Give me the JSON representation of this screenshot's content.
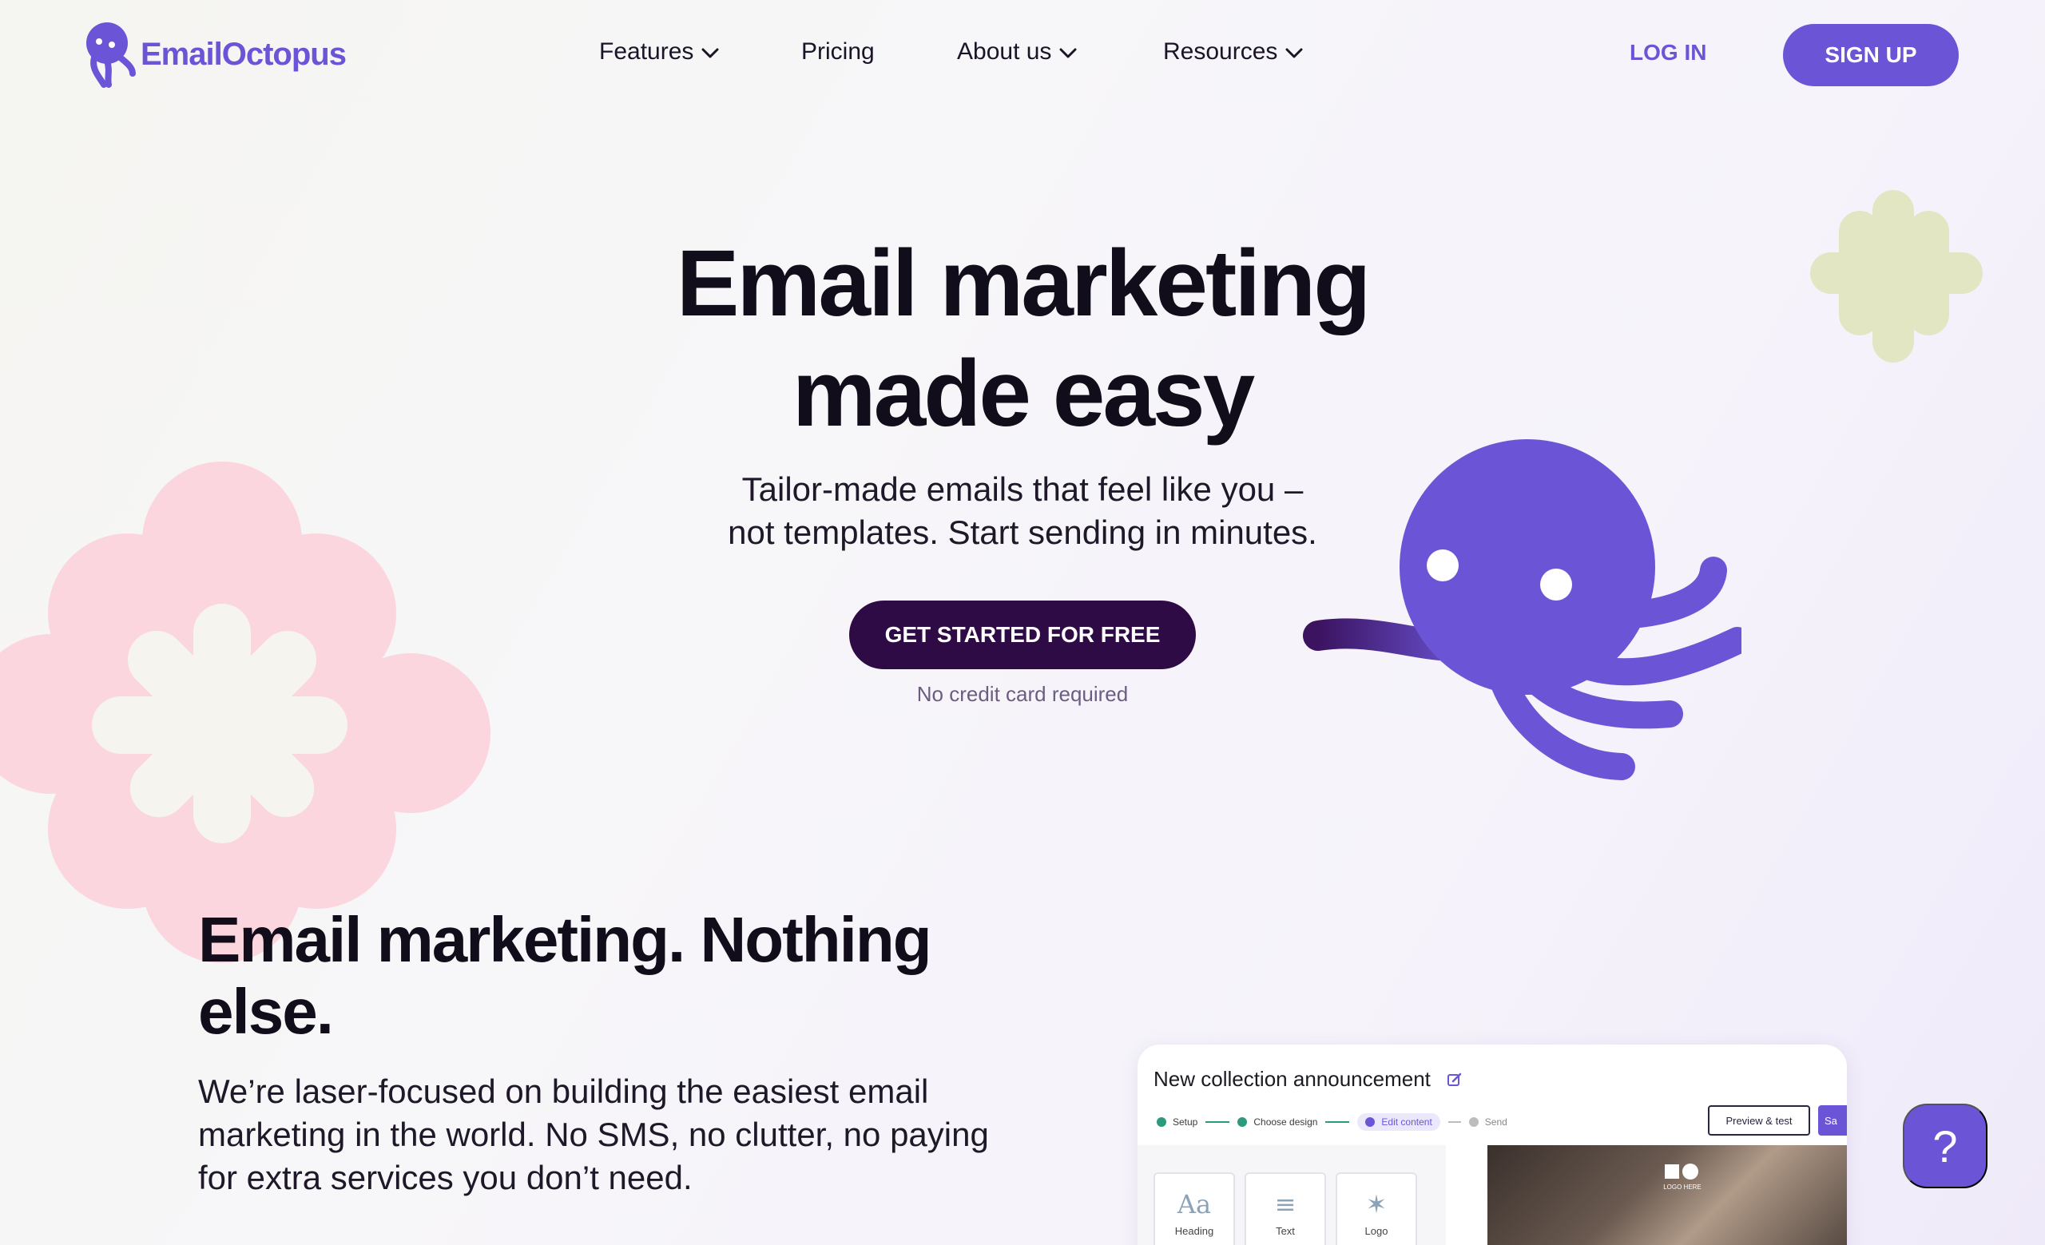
{
  "brand": {
    "name": "EmailOctopus",
    "accent_color": "#6b55d6",
    "dark_button_color": "#2e0b45"
  },
  "nav": {
    "features": "Features",
    "pricing": "Pricing",
    "about": "About us",
    "resources": "Resources",
    "login": "LOG IN",
    "signup": "SIGN UP"
  },
  "hero": {
    "title_line1": "Email marketing",
    "title_line2": "made easy",
    "subtitle_line1": "Tailor-made emails that feel like you –",
    "subtitle_line2": "not templates. Start sending in minutes.",
    "cta": "GET STARTED FOR FREE",
    "cta_note": "No credit card required"
  },
  "section": {
    "title_line1": "Email marketing. Nothing",
    "title_line2": "else.",
    "body": "We’re laser-focused on building the easiest email marketing in the world. No SMS, no clutter, no paying for extra services you don’t need."
  },
  "preview": {
    "title": "New collection announcement",
    "steps": [
      "Setup",
      "Choose design",
      "Edit content",
      "Send"
    ],
    "active_step": "Edit content",
    "preview_button": "Preview & test",
    "save_button": "Sa",
    "blocks": [
      {
        "glyph": "Aa",
        "label": "Heading"
      },
      {
        "glyph": "≡",
        "label": "Text"
      },
      {
        "glyph": "✶",
        "label": "Logo"
      }
    ],
    "photo_logo": "LOGO HERE"
  },
  "help": {
    "label": "?"
  },
  "icons": [
    "octopus-logo-icon",
    "chevron-down-icon",
    "edit-icon",
    "question-icon"
  ]
}
